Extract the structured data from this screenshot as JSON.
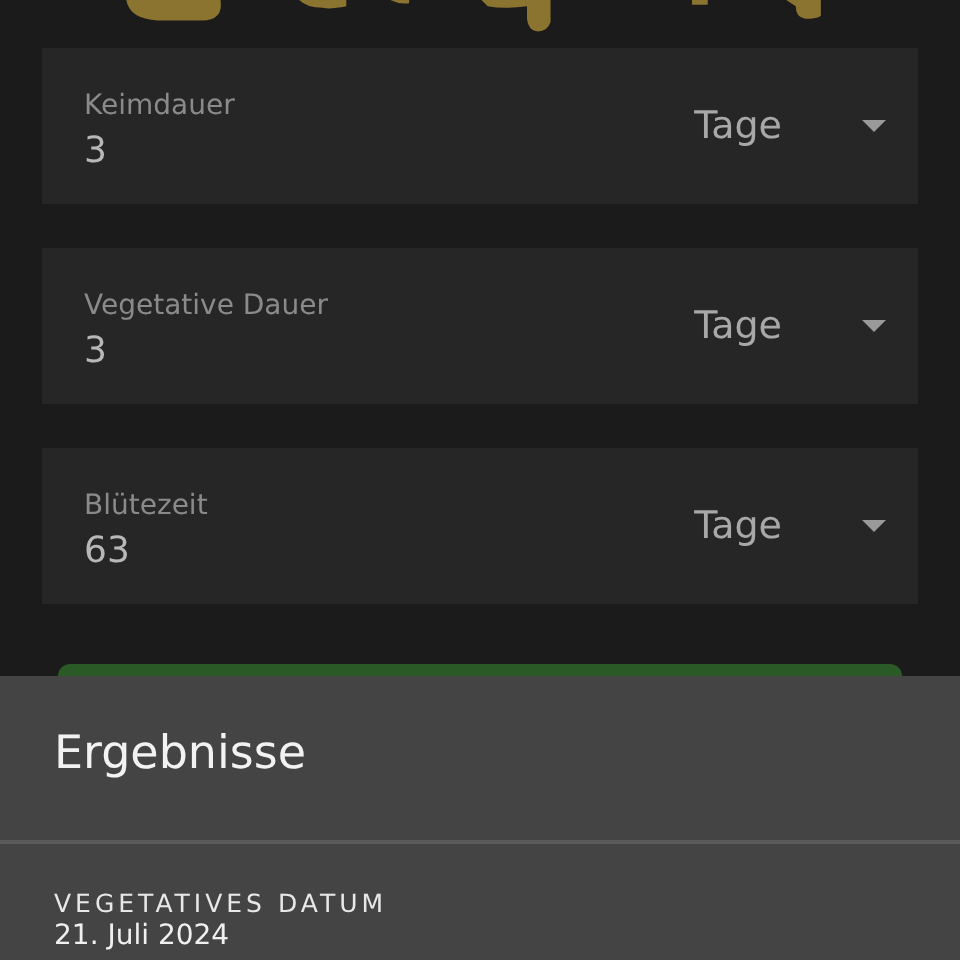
{
  "fields": [
    {
      "label": "Keimdauer",
      "value": "3",
      "unit": "Tage"
    },
    {
      "label": "Vegetative Dauer",
      "value": "3",
      "unit": "Tage"
    },
    {
      "label": "Blütezeit",
      "value": "63",
      "unit": "Tage"
    }
  ],
  "sheet": {
    "title": "Ergebnisse",
    "results": [
      {
        "label": "VEGETATIVES DATUM",
        "value": "21. Juli 2024"
      }
    ]
  }
}
